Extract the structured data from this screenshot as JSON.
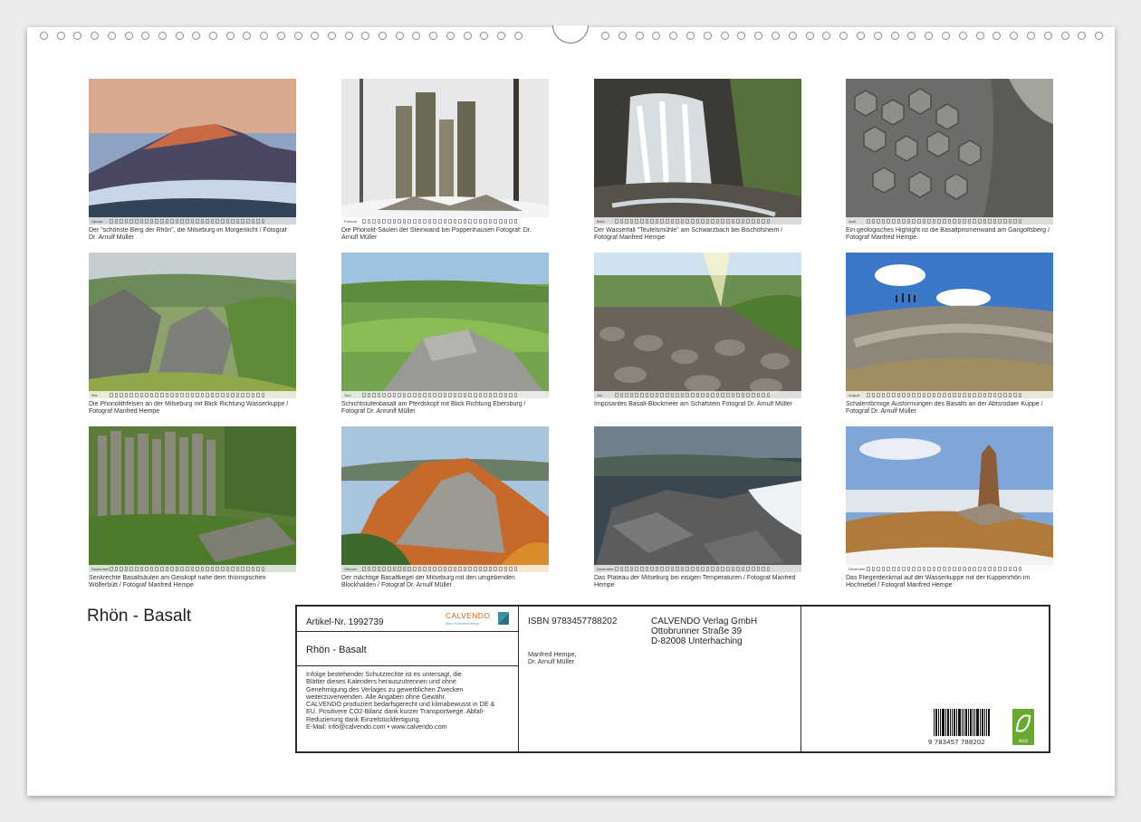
{
  "calendar": {
    "title": "Rhön - Basalt",
    "photos": [
      {
        "month": "Januar",
        "caption": "Der \"schönste Berg der Rhön\", die Milseburg im Morgenlicht / Fotograf Dr. Arnulf Müller",
        "scene": "mountain-sunrise"
      },
      {
        "month": "Februar",
        "caption": "Die Phonolit-Säulen der Steinwand bei Poppenhausen Fotograf: Dr. Arnulf Müller",
        "scene": "rock-snow"
      },
      {
        "month": "März",
        "caption": "Der Wasserfall \"Teufelsmühle\" am Schwarzbach bei Bischofsheim / Fotograf Manfred Hempe",
        "scene": "waterfall"
      },
      {
        "month": "April",
        "caption": "Ein geologisches Highlight ist die Basaltprismenwand am Gangolfsberg / Fotograf Manfred Hempe.",
        "scene": "basalt-prisms"
      },
      {
        "month": "Mai",
        "caption": "Die Phonolithfelsen an der Milseburg mit Blick Richtung Wasserkuppe / Fotograf Manfred Hempe",
        "scene": "green-rocks"
      },
      {
        "month": "Juni",
        "caption": "Schichtstufenbasalt am Pferdskopf mit Blick Richtung Ebersburg / Fotograf Dr. Anrunlf Müller",
        "scene": "green-valley"
      },
      {
        "month": "Juli",
        "caption": "Imposantes Basalt-Blockmeer am Schafstein Fotograf Dr. Arnulf Müller",
        "scene": "block-sea"
      },
      {
        "month": "August",
        "caption": "Schalenförmige Ausformungen des Basalts an der Abtsrodaer Kuppe / Fotograf Dr. Arnulf Müller",
        "scene": "hikers"
      },
      {
        "month": "September",
        "caption": "Senkrechte Basaltsäulen am Geiskopf nahe dem thüringischen Wölferbütt / Fotograf Manfred Hempe",
        "scene": "columns-forest"
      },
      {
        "month": "Oktober",
        "caption": "Der mächtige Basaltkegel der Milseburg mit den umgebenden Blockhalden / Fotograf Dr. Arnulf Müller",
        "scene": "autumn-hill"
      },
      {
        "month": "November",
        "caption": "Das Plateau der Milseburg bei eisigen Temperaturen / Fotograf Manfred Hempe",
        "scene": "frozen-plateau"
      },
      {
        "month": "Dezember",
        "caption": "Das Fliegerdenkmal auf der Wasserkuppe mit der Kuppenrhön im Hochnebel / Fotograf Manfred Hempe",
        "scene": "monument"
      }
    ]
  },
  "info": {
    "article": "Artikel-Nr. 1992739",
    "logo_name": "CALVENDO",
    "logo_tag": "Mein Kalenderverlag",
    "title": "Rhön - Basalt",
    "legal_lines": [
      "Infolge bestehender Schutzrechte ist es untersagt, die",
      "Blätter dieses Kalenders herauszutrennen und ohne",
      "Genehmigung des Verlages zu gewerblichen Zwecken",
      "weiterzuverwenden. Alle Angaben ohne Gewähr.",
      "CALVENDO produziert bedarfsgerecht und klimabewusst in DE &",
      "EU. Positivere CO2-Bilanz dank kurzer Transportwege. Abfall-",
      "Reduzierung dank Einzelstückfertigung.",
      "E-Mail: info@calvendo.com • www.calvendo.com"
    ],
    "isbn": "ISBN 9783457788202",
    "publisher_lines": [
      "CALVENDO Verlag GmbH",
      "Ottobrunner Straße 39",
      "D-82008 Unterhaching"
    ],
    "author_lines": [
      "Manfred Hempe,",
      "Dr. Arnulf Müller"
    ],
    "barcode_number": "9  783457  788202",
    "eco_label": "eco"
  }
}
